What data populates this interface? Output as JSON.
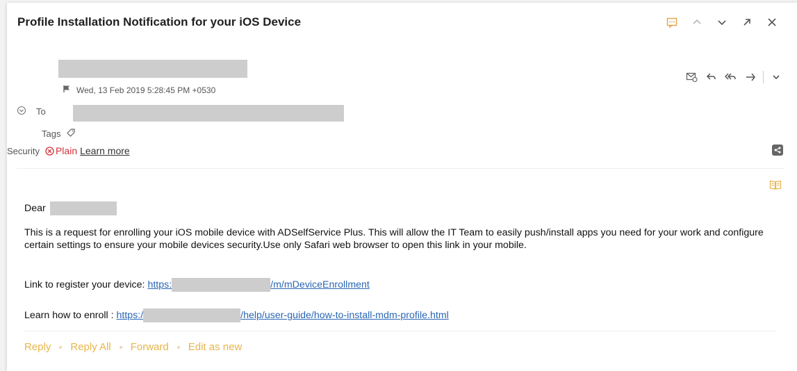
{
  "email": {
    "subject": "Profile Installation Notification for your iOS Device",
    "date": "Wed, 13 Feb 2019 5:28:45 PM +0530",
    "to_label": "To",
    "tags_label": "Tags",
    "security_label": "Security",
    "security_status": "Plain",
    "learn_more": "Learn more"
  },
  "body": {
    "greeting": "Dear",
    "paragraph": "This is a request for enrolling your iOS mobile device with ADSelfService Plus. This will allow the IT Team to easily push/install apps you need for your work and configure certain settings to ensure your mobile devices security.Use only Safari web browser to open this link in your mobile.",
    "register_label": "Link to register your device:",
    "register_link_start": "https:",
    "register_link_end": "/m/mDeviceEnrollment",
    "enroll_label": "Learn how to enroll :",
    "enroll_link_start": "https:/",
    "enroll_link_end": "/help/user-guide/how-to-install-mdm-profile.html"
  },
  "footer": {
    "reply": "Reply",
    "reply_all": "Reply All",
    "forward": "Forward",
    "edit_as_new": "Edit as new"
  },
  "colors": {
    "accent": "#e6b54a",
    "security_red": "#d0323b",
    "link": "#2a66b4"
  },
  "icons": {
    "top": [
      "thread-view-icon",
      "chevron-up-icon",
      "chevron-down-icon",
      "popout-icon",
      "close-icon"
    ],
    "actions": [
      "mark-unread-icon",
      "reply-icon",
      "reply-all-icon",
      "forward-icon",
      "more-chevron-icon"
    ]
  }
}
